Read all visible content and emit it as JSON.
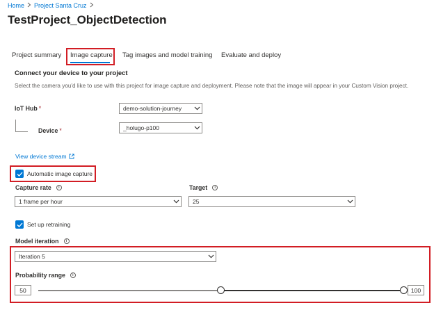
{
  "breadcrumb": {
    "items": [
      "Home",
      "Project Santa Cruz"
    ]
  },
  "page": {
    "title": "TestProject_ObjectDetection",
    "more_label": "···"
  },
  "tabs": [
    {
      "label": "Project summary"
    },
    {
      "label": "Image capture",
      "active": true
    },
    {
      "label": "Tag images and model training"
    },
    {
      "label": "Evaluate and deploy"
    }
  ],
  "section": {
    "heading": "Connect your device to your project",
    "description": "Select the camera you'd like to use with this project for image capture and deployment. Please note that the image will appear in your Custom Vision project."
  },
  "iot_hub": {
    "label": "IoT Hub",
    "required_mark": "*",
    "value": "demo-solution-journey"
  },
  "device": {
    "label": "Device",
    "required_mark": "*",
    "value": "_holugo-p100"
  },
  "view_stream": {
    "label": "View device stream",
    "icon": "external-link-icon"
  },
  "auto_capture": {
    "label": "Automatic image capture",
    "checked": true
  },
  "capture_rate": {
    "label": "Capture rate",
    "value": "1 frame per hour"
  },
  "target": {
    "label": "Target",
    "value": "25"
  },
  "retraining": {
    "label": "Set up retraining",
    "checked": true
  },
  "model_iteration": {
    "label": "Model iteration",
    "value": "Iteration 5"
  },
  "probability": {
    "label": "Probability range",
    "min_value": "50",
    "max_value": "100",
    "range_min": 0,
    "range_max": 100
  },
  "colors": {
    "accent": "#0078d4",
    "highlight": "#d21d24",
    "text": "#323130"
  }
}
